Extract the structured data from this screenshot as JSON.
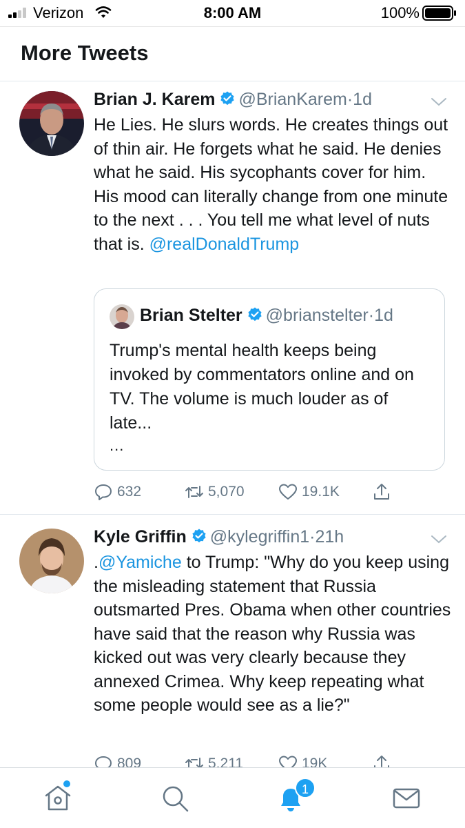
{
  "status_bar": {
    "carrier": "Verizon",
    "time": "8:00 AM",
    "battery": "100%",
    "icons": [
      "signal-icon",
      "wifi-icon",
      "battery-icon"
    ]
  },
  "header": {
    "title": "More Tweets"
  },
  "tweets": [
    {
      "name": "Brian J. Karem",
      "handle": "@BrianKarem",
      "separator": "·",
      "time": "1d",
      "text": "He Lies. He slurs words. He creates things out of thin air. He forgets what he said. He denies what he said. His sycophants cover for him. His mood can literally change from one minute to the next . . . You tell me what level of nuts that is. ",
      "mention": "@realDonaldTrump",
      "quote": {
        "name": "Brian Stelter",
        "handle": "@brianstelter",
        "separator": "·",
        "time": "1d",
        "text": "Trump's mental health keeps being invoked by commentators online and on TV. The volume is much louder as of late...",
        "ellipsis": "..."
      },
      "replies": "632",
      "retweets": "5,070",
      "likes": "19.1K"
    },
    {
      "name": "Kyle Griffin",
      "handle": "@kylegriffin1",
      "separator": "·",
      "time": "21h",
      "text_prefix": ".",
      "mention": "@Yamiche",
      "text": " to Trump: \"Why do you keep using the misleading statement that Russia outsmarted Pres. Obama when other countries have said that the reason why Russia was kicked out was very clearly because they annexed Crimea. Why keep repeating what some people would see as a lie?\"",
      "replies": "809",
      "retweets": "5,211",
      "likes": "19K"
    }
  ],
  "tabbar": {
    "items": [
      "home-icon",
      "search-icon",
      "notifications-icon",
      "messages-icon"
    ],
    "notification_count": "1"
  },
  "colors": {
    "accent": "#1da1f2",
    "link": "#1b95e0",
    "secondary_text": "#657786",
    "primary_text": "#14171a",
    "border": "#e1e8ed"
  }
}
